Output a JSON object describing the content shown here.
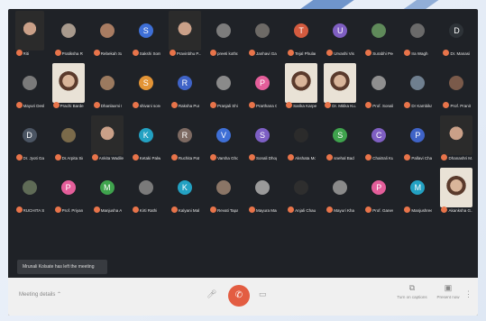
{
  "colors": {
    "mic_badge": "#e8744a",
    "hangup": "#e35d42"
  },
  "rows": [
    [
      {
        "t": "p",
        "n": "Riti"
      },
      {
        "t": "a",
        "n": "Pratiksha Ra...",
        "c": "#a89a8d",
        "l": ""
      },
      {
        "t": "a",
        "n": "Rebekah Salel",
        "c": "#a87c62",
        "l": ""
      },
      {
        "t": "a",
        "n": "Sakshi Sonta...",
        "c": "#3e6fd6",
        "l": "S"
      },
      {
        "t": "p",
        "n": "Pravinbhu P...",
        "big": true
      },
      {
        "t": "a",
        "n": "preeti kothra...",
        "c": "#7c7c7c",
        "l": ""
      },
      {
        "t": "a",
        "n": "Janhavi Gan...",
        "c": "#6d6a66",
        "l": ""
      },
      {
        "t": "a",
        "n": "Tejal Phulare",
        "c": "#d35b3f",
        "l": "T"
      },
      {
        "t": "a",
        "n": "Urvashi Vish...",
        "c": "#7f5fc2",
        "l": "U"
      },
      {
        "t": "a",
        "n": "Surabhi Pedn...",
        "c": "#5f8a5a",
        "l": ""
      },
      {
        "t": "a",
        "n": "Ira Wagh",
        "c": "#6a6a6a",
        "l": ""
      },
      {
        "t": "a",
        "n": "Dr. Manasi J...",
        "c": "#2e3338",
        "l": "D"
      }
    ],
    [
      {
        "t": "a",
        "n": "Mayuri Desh...",
        "c": "#7a7a7a",
        "l": ""
      },
      {
        "t": "p",
        "n": "Prachi Barde",
        "big": true
      },
      {
        "t": "a",
        "n": "Dhanlaxmi K...",
        "c": "#9b7a5f",
        "l": ""
      },
      {
        "t": "a",
        "n": "shivani sonc...",
        "c": "#e39436",
        "l": "S"
      },
      {
        "t": "a",
        "n": "Raksha Pure...",
        "c": "#3f63c7",
        "l": "R"
      },
      {
        "t": "a",
        "n": "Pranjali Shin...",
        "c": "#8a8a8a",
        "l": ""
      },
      {
        "t": "a",
        "n": "Prarthana G...",
        "c": "#e45e9a",
        "l": "P"
      },
      {
        "t": "p",
        "n": "Sarika Karpe",
        "big": true
      },
      {
        "t": "p",
        "n": "Dr. Mitika Ku...",
        "big": true
      },
      {
        "t": "a",
        "n": "Prof. Sonali ...",
        "c": "#8f8f8f",
        "l": ""
      },
      {
        "t": "a",
        "n": "Dr Kambikar...",
        "c": "#6f7f8f",
        "l": ""
      },
      {
        "t": "a",
        "n": "Prof. Pranita ...",
        "c": "#7a5a4a",
        "l": ""
      }
    ],
    [
      {
        "t": "a",
        "n": "Dr. Jyoti Gaik...",
        "c": "#4b5563",
        "l": "D"
      },
      {
        "t": "a",
        "n": "Dr.Arpita Sin...",
        "c": "#7a6a4a",
        "l": ""
      },
      {
        "t": "p",
        "n": "Ankita Wadile",
        "big": true
      },
      {
        "t": "a",
        "n": "Ketaki Palwa...",
        "c": "#23a1c2",
        "l": "K"
      },
      {
        "t": "a",
        "n": "Ruchita Patil",
        "c": "#7d6a62",
        "l": "R"
      },
      {
        "t": "a",
        "n": "Varsha Ghon...",
        "c": "#3e6fd6",
        "l": "V"
      },
      {
        "t": "a",
        "n": "Sonali Dhoge",
        "c": "#7d5fc4",
        "l": "S"
      },
      {
        "t": "a",
        "n": "Akshata More",
        "c": "#2b2b2b",
        "l": ""
      },
      {
        "t": "a",
        "n": "snehal Badhan",
        "c": "#3fa34d",
        "l": "S"
      },
      {
        "t": "a",
        "n": "Chaitrali Kull...",
        "c": "#7f5fc2",
        "l": "C"
      },
      {
        "t": "a",
        "n": "Pallavi Chaval...",
        "c": "#3f63c7",
        "l": "P"
      },
      {
        "t": "p",
        "n": "Dhanashri M...",
        "big": true
      }
    ],
    [
      {
        "t": "a",
        "n": "RUCHITA SH...",
        "c": "#5f6b56",
        "l": ""
      },
      {
        "t": "a",
        "n": "Prof. Priyank...",
        "c": "#e45e9a",
        "l": "P"
      },
      {
        "t": "a",
        "n": "Manjusha Ar...",
        "c": "#3fa34d",
        "l": "M"
      },
      {
        "t": "a",
        "n": "Kirti Rathi",
        "c": "#7a7a7a",
        "l": ""
      },
      {
        "t": "a",
        "n": "Kalyani Mali",
        "c": "#23a1c2",
        "l": "K"
      },
      {
        "t": "a",
        "n": "Revati Tapas...",
        "c": "#8a7566",
        "l": ""
      },
      {
        "t": "a",
        "n": "Mayura Mar...",
        "c": "#9a9a9a",
        "l": ""
      },
      {
        "t": "a",
        "n": "Anjali Chaud...",
        "c": "#2e2e2e",
        "l": ""
      },
      {
        "t": "a",
        "n": "Mayuri Kharà...",
        "c": "#8a8a8a",
        "l": ""
      },
      {
        "t": "a",
        "n": "Prof. Ganesh...",
        "c": "#e45e9a",
        "l": "P"
      },
      {
        "t": "a",
        "n": "Manjushree ...",
        "c": "#23a1c2",
        "l": "M"
      },
      {
        "t": "p",
        "n": "Akanksha G...",
        "big": true
      }
    ]
  ],
  "toast": "Mrunali Kolsate has left the meeting",
  "bottom": {
    "meeting_details": "Meeting details",
    "chevron": "⌃",
    "hangup_icon": "✆",
    "cc_icon": "⧉",
    "present_icon": "▣",
    "captions_label": "Turn on captions",
    "present_label": "Present now",
    "more_icon": "⋮",
    "mic_icon": "🎤︎",
    "cam_icon": "▭"
  }
}
